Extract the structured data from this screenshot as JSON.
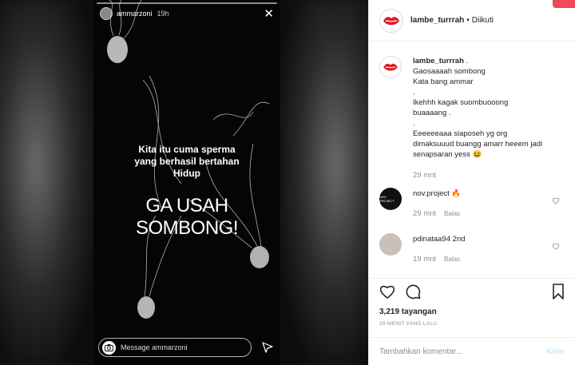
{
  "story": {
    "username": "ammarzoni",
    "time": "19h",
    "caption_lines": [
      "Kita itu cuma sperma",
      "yang berhasil bertahan",
      "Hidup"
    ],
    "big_text": "GA USAH SOMBONG!",
    "message_placeholder": "Message ammarzoni"
  },
  "post": {
    "owner": "lambe_turrrah",
    "separator": "•",
    "follow_status": "Diikuti",
    "caption": {
      "username": "lambe_turrrah",
      "lines": [
        ".",
        "Gaosaaaah sombong",
        "Kata bang ammar",
        ".",
        "Ikehhh kagak suombuooong",
        "buaaaang .",
        ".",
        "Eeeeeeaaa siaposeh yg org",
        "dimaksuuud buangg amarr heeem jadi",
        "senapsaran yess 😆"
      ],
      "time": "29 mnt"
    },
    "comments": [
      {
        "username": "nov.project",
        "text": "🔥",
        "time": "29 mnt",
        "reply": "Balas",
        "avatar_label": "NOV PROJECT"
      },
      {
        "username": "pdinataa94",
        "text": "2nd",
        "time": "19 mnt",
        "reply": "Balas"
      }
    ],
    "views": "3,219 tayangan",
    "posted_ago": "29 MENIT YANG LALU",
    "comment_placeholder": "Tambahkan komentar...",
    "post_button": "Kirim"
  },
  "icons": [
    "close-icon",
    "camera-icon",
    "send-icon",
    "heart-icon",
    "comment-icon",
    "bookmark-icon"
  ],
  "colors": {
    "accent_red": "#ed4956",
    "post_button": "#b2dffc",
    "muted": "#8e8e8e"
  }
}
